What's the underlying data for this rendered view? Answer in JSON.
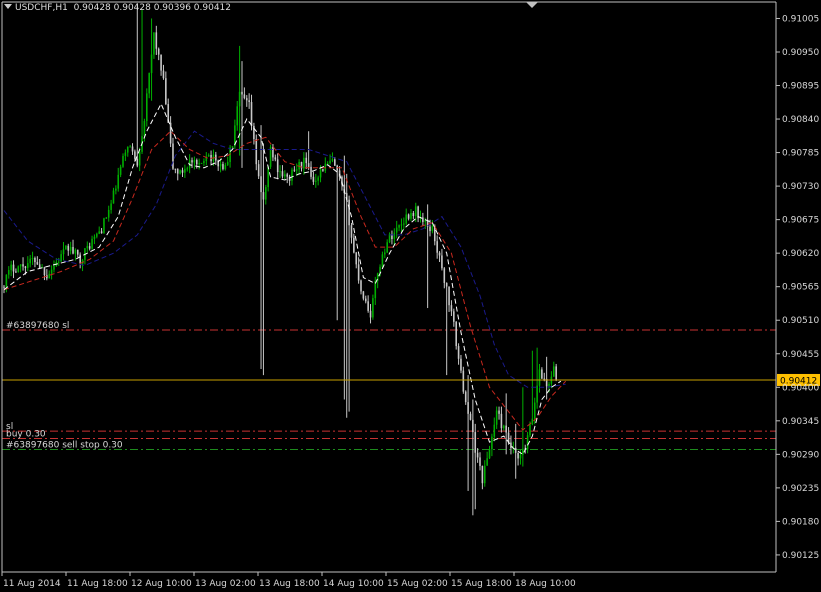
{
  "header": {
    "symbol": "USDCHF,H1",
    "ohlc": "0.90428 0.90428 0.90396 0.90412"
  },
  "colors": {
    "background": "#000000",
    "axis": "#c0c0c0",
    "bull_candle": "#00b000",
    "bear_candle": "#c8c8c8",
    "ma_fast": "#ffffff",
    "ma_mid": "#c8281e",
    "ma_slow": "#1a1a8c",
    "current_price_line": "#c8a000",
    "current_price_label_bg": "#ffc000",
    "stop_line": "#c83232",
    "green_line": "#1e8c1e"
  },
  "chart_data": {
    "type": "candlestick",
    "ylim": [
      0.90097,
      0.91032
    ],
    "price_ticks": [
      "0.91005",
      "0.90950",
      "0.90895",
      "0.90840",
      "0.90785",
      "0.90730",
      "0.90675",
      "0.90620",
      "0.90565",
      "0.90510",
      "0.90455",
      "0.90400",
      "0.90345",
      "0.90290",
      "0.90235",
      "0.90180",
      "0.90125"
    ],
    "time_ticks": [
      "11 Aug 2014",
      "11 Aug 18:00",
      "12 Aug 10:00",
      "13 Aug 02:00",
      "13 Aug 18:00",
      "14 Aug 10:00",
      "15 Aug 02:00",
      "15 Aug 18:00",
      "18 Aug 10:00"
    ],
    "current_price": {
      "value": 0.90412,
      "label": "0.90412"
    },
    "order_lines": [
      {
        "name": "sl-line-1",
        "price": 0.90494,
        "label": "#63897680 sl",
        "color": "#c83232"
      },
      {
        "name": "sl-line-2",
        "price": 0.90328,
        "label": "sl",
        "color": "#c83232"
      },
      {
        "name": "buy-line",
        "price": 0.90316,
        "label": "buy 0.30",
        "color": "#c83232"
      },
      {
        "name": "sell-stop-line",
        "price": 0.90298,
        "label": "#63897680 sell stop 0.30",
        "color": "#1e8c1e"
      }
    ],
    "anchors": [
      [
        0,
        0.90565,
        0.90595
      ],
      [
        4,
        0.90595,
        0.906
      ],
      [
        9,
        0.906,
        0.9061
      ],
      [
        14,
        0.9061,
        0.90585
      ],
      [
        19,
        0.90585,
        0.9061
      ],
      [
        24,
        0.9061,
        0.9063
      ],
      [
        28,
        0.9063,
        0.9061
      ],
      [
        33,
        0.9061,
        0.9064
      ],
      [
        38,
        0.9064,
        0.9066
      ],
      [
        42,
        0.9066,
        0.907
      ],
      [
        46,
        0.907,
        0.9076
      ],
      [
        50,
        0.9076,
        0.908
      ],
      [
        53,
        0.908,
        0.9077
      ],
      [
        57,
        0.9077,
        0.9084
      ],
      [
        60,
        0.9084,
        0.9098
      ],
      [
        64,
        0.9098,
        0.909
      ],
      [
        68,
        0.909,
        0.9076
      ],
      [
        72,
        0.9076,
        0.9075
      ],
      [
        75,
        0.9075,
        0.9077
      ],
      [
        79,
        0.9077,
        0.9076
      ],
      [
        83,
        0.9076,
        0.90785
      ],
      [
        86,
        0.90785,
        0.9077
      ],
      [
        90,
        0.9077,
        0.9076
      ],
      [
        94,
        0.9076,
        0.908
      ],
      [
        97,
        0.908,
        0.9088
      ],
      [
        100,
        0.9088,
        0.9086
      ],
      [
        104,
        0.9086,
        0.9077
      ],
      [
        107,
        0.9077,
        0.907
      ],
      [
        110,
        0.907,
        0.9079
      ],
      [
        113,
        0.9079,
        0.9076
      ],
      [
        116,
        0.9076,
        0.9074
      ],
      [
        120,
        0.9074,
        0.9076
      ],
      [
        124,
        0.9076,
        0.9077
      ],
      [
        127,
        0.9077,
        0.9074
      ],
      [
        131,
        0.9074,
        0.9076
      ],
      [
        135,
        0.9076,
        0.9077
      ],
      [
        139,
        0.9077,
        0.9074
      ],
      [
        142,
        0.9074,
        0.907
      ],
      [
        145,
        0.907,
        0.9062
      ],
      [
        148,
        0.9062,
        0.9056
      ],
      [
        151,
        0.9056,
        0.9052
      ],
      [
        155,
        0.9052,
        0.9059
      ],
      [
        158,
        0.9059,
        0.9064
      ],
      [
        162,
        0.9064,
        0.9066
      ],
      [
        166,
        0.9066,
        0.9068
      ],
      [
        170,
        0.9068,
        0.9069
      ],
      [
        174,
        0.9069,
        0.9067
      ],
      [
        177,
        0.9067,
        0.9066
      ],
      [
        181,
        0.9066,
        0.9061
      ],
      [
        184,
        0.9061,
        0.9056
      ],
      [
        187,
        0.9056,
        0.905
      ],
      [
        190,
        0.905,
        0.9042
      ],
      [
        193,
        0.9042,
        0.9036
      ],
      [
        196,
        0.9036,
        0.903
      ],
      [
        199,
        0.903,
        0.9025
      ],
      [
        202,
        0.9025,
        0.903
      ],
      [
        205,
        0.903,
        0.9036
      ],
      [
        208,
        0.9036,
        0.9033
      ],
      [
        211,
        0.9033,
        0.903
      ],
      [
        214,
        0.903,
        0.9028
      ],
      [
        217,
        0.9028,
        0.903
      ],
      [
        220,
        0.903,
        0.9035
      ],
      [
        223,
        0.9035,
        0.9043
      ],
      [
        226,
        0.9043,
        0.904
      ],
      [
        229,
        0.904,
        0.9043
      ],
      [
        232,
        0.9043,
        0.90412
      ]
    ],
    "spikes": [
      [
        56,
        0.9087,
        0.9103
      ],
      [
        58,
        0.9086,
        0.9102
      ],
      [
        62,
        0.9087,
        0.91005
      ],
      [
        99,
        0.9078,
        0.9096
      ],
      [
        100,
        0.9076,
        0.90935
      ],
      [
        108,
        0.9043,
        0.9083
      ],
      [
        109,
        0.9042,
        0.908
      ],
      [
        128,
        0.9077,
        0.9082
      ],
      [
        140,
        0.9051,
        0.9076
      ],
      [
        143,
        0.9038,
        0.9078
      ],
      [
        144,
        0.9035,
        0.9075
      ],
      [
        145,
        0.9036,
        0.9064
      ],
      [
        178,
        0.9053,
        0.907
      ],
      [
        186,
        0.9042,
        0.9056
      ],
      [
        195,
        0.9023,
        0.9042
      ],
      [
        197,
        0.9019,
        0.9038
      ],
      [
        198,
        0.902,
        0.9034
      ],
      [
        211,
        0.9029,
        0.9039
      ],
      [
        215,
        0.9025,
        0.9034
      ],
      [
        218,
        0.9027,
        0.904
      ],
      [
        222,
        0.9035,
        0.9046
      ],
      [
        224,
        0.9038,
        0.90465
      ],
      [
        228,
        0.9038,
        0.9045
      ]
    ],
    "ma_fast": [
      [
        0,
        0.9056
      ],
      [
        10,
        0.9059
      ],
      [
        20,
        0.906
      ],
      [
        30,
        0.9061
      ],
      [
        40,
        0.9063
      ],
      [
        48,
        0.9068
      ],
      [
        54,
        0.9076
      ],
      [
        60,
        0.9082
      ],
      [
        66,
        0.90865
      ],
      [
        72,
        0.9081
      ],
      [
        78,
        0.90765
      ],
      [
        84,
        0.9076
      ],
      [
        90,
        0.9077
      ],
      [
        96,
        0.9079
      ],
      [
        102,
        0.9084
      ],
      [
        108,
        0.9081
      ],
      [
        112,
        0.90745
      ],
      [
        118,
        0.9074
      ],
      [
        124,
        0.9075
      ],
      [
        130,
        0.90755
      ],
      [
        136,
        0.90765
      ],
      [
        141,
        0.9075
      ],
      [
        146,
        0.9068
      ],
      [
        151,
        0.9058
      ],
      [
        156,
        0.9057
      ],
      [
        162,
        0.9062
      ],
      [
        168,
        0.9066
      ],
      [
        174,
        0.9068
      ],
      [
        180,
        0.9067
      ],
      [
        186,
        0.9062
      ],
      [
        192,
        0.9049
      ],
      [
        198,
        0.9038
      ],
      [
        204,
        0.9031
      ],
      [
        210,
        0.9032
      ],
      [
        214,
        0.903
      ],
      [
        218,
        0.9029
      ],
      [
        222,
        0.9032
      ],
      [
        226,
        0.9038
      ],
      [
        230,
        0.904
      ],
      [
        234,
        0.9041
      ]
    ],
    "ma_mid": [
      [
        0,
        0.9056
      ],
      [
        12,
        0.90575
      ],
      [
        24,
        0.9059
      ],
      [
        36,
        0.9061
      ],
      [
        46,
        0.9064
      ],
      [
        54,
        0.9071
      ],
      [
        62,
        0.9079
      ],
      [
        70,
        0.9082
      ],
      [
        78,
        0.9079
      ],
      [
        86,
        0.90775
      ],
      [
        94,
        0.9078
      ],
      [
        102,
        0.908
      ],
      [
        110,
        0.9081
      ],
      [
        118,
        0.9077
      ],
      [
        126,
        0.9076
      ],
      [
        134,
        0.9076
      ],
      [
        142,
        0.9076
      ],
      [
        150,
        0.9068
      ],
      [
        156,
        0.9063
      ],
      [
        164,
        0.9063
      ],
      [
        172,
        0.9066
      ],
      [
        180,
        0.9067
      ],
      [
        188,
        0.9062
      ],
      [
        196,
        0.905
      ],
      [
        204,
        0.904
      ],
      [
        212,
        0.9036
      ],
      [
        218,
        0.9033
      ],
      [
        224,
        0.9035
      ],
      [
        230,
        0.90385
      ],
      [
        236,
        0.9041
      ]
    ],
    "ma_slow": [
      [
        0,
        0.9069
      ],
      [
        10,
        0.9064
      ],
      [
        22,
        0.9061
      ],
      [
        34,
        0.906
      ],
      [
        46,
        0.9062
      ],
      [
        56,
        0.9065
      ],
      [
        64,
        0.907
      ],
      [
        72,
        0.9078
      ],
      [
        80,
        0.9082
      ],
      [
        88,
        0.908
      ],
      [
        96,
        0.9079
      ],
      [
        104,
        0.9079
      ],
      [
        112,
        0.9079
      ],
      [
        120,
        0.9079
      ],
      [
        128,
        0.9079
      ],
      [
        136,
        0.9078
      ],
      [
        144,
        0.9077
      ],
      [
        152,
        0.9071
      ],
      [
        160,
        0.9065
      ],
      [
        168,
        0.9065
      ],
      [
        176,
        0.9066
      ],
      [
        184,
        0.9068
      ],
      [
        192,
        0.9063
      ],
      [
        200,
        0.9055
      ],
      [
        206,
        0.9047
      ],
      [
        212,
        0.9042
      ],
      [
        220,
        0.904
      ],
      [
        228,
        0.904
      ],
      [
        236,
        0.90405
      ]
    ]
  }
}
